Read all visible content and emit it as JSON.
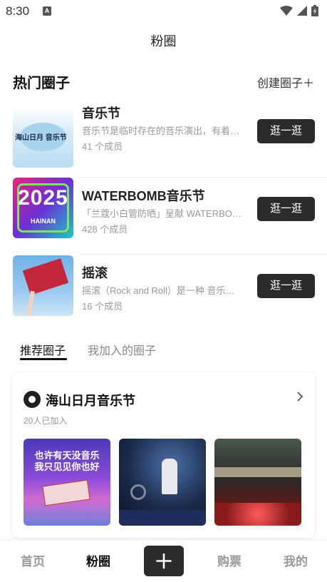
{
  "status_bar": {
    "time": "8:30",
    "notification_badge": "A"
  },
  "header": {
    "title": "粉圈"
  },
  "hot_section": {
    "title": "热门圈子",
    "create_label": "创建圈子＋",
    "circles": [
      {
        "name": "音乐节",
        "description": "音乐节是临时存在的音乐演出，有着…",
        "members": "41 个成员",
        "button": "逛一逛",
        "thumb_text": "海山日月 音乐节"
      },
      {
        "name": "WATERBOMB音乐节",
        "description": "「兰蔻小白管防晒」呈献 WATERBO…",
        "members": "428 个成员",
        "button": "逛一逛",
        "thumb_text_year": "2025",
        "thumb_text_place": "HAINAN"
      },
      {
        "name": "摇滚",
        "description": "摇滚（Rock and Roll）是一种 音乐…",
        "members": "16 个成员",
        "button": "逛一逛"
      }
    ]
  },
  "tabs": {
    "recommended": "推荐圈子",
    "joined": "我加入的圈子"
  },
  "recommended_card": {
    "title": "海山日月音乐节",
    "joined_text": "20人已加入",
    "photo1_line1": "也许有天没音乐",
    "photo1_line2": "我只见见你也好"
  },
  "bottom_nav": {
    "home": "首页",
    "fan_circle": "粉圈",
    "tickets": "购票",
    "mine": "我的"
  },
  "colors": {
    "accent_dark": "#2b2b2b",
    "muted_text": "#999999"
  }
}
